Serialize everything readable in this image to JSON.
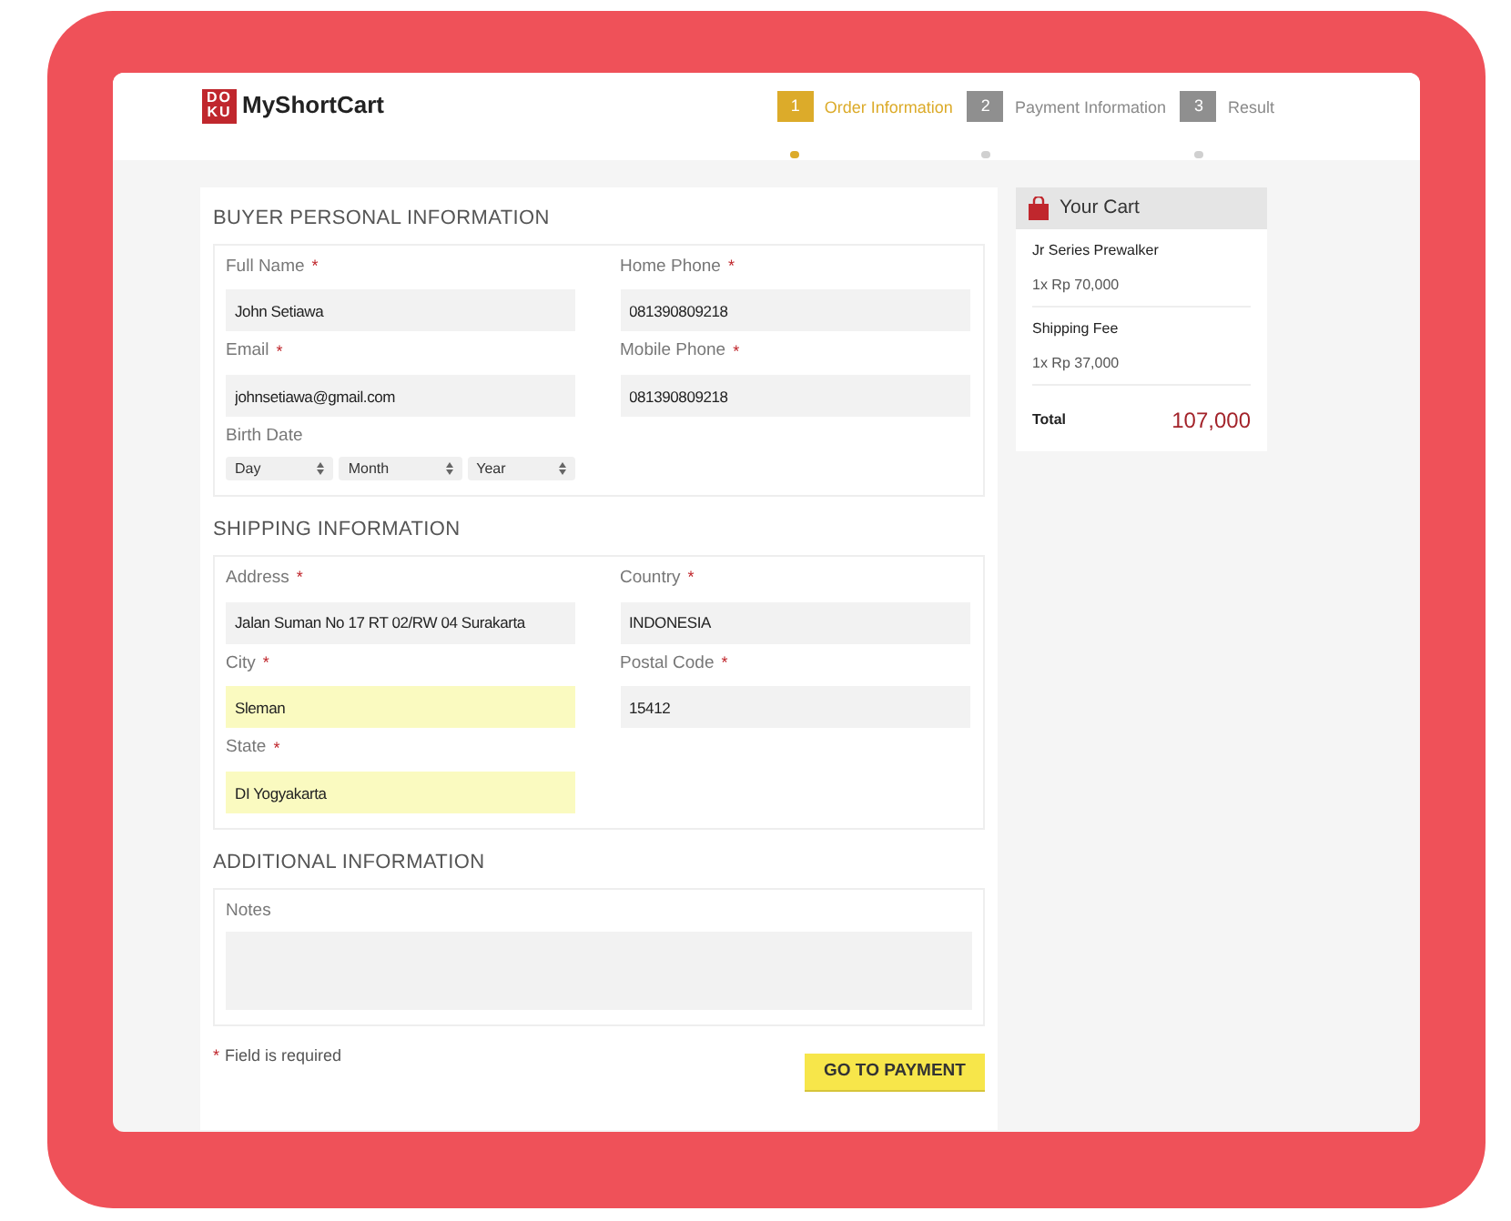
{
  "brand": {
    "logo_mark_lines": [
      "DO",
      "KU"
    ],
    "name": "MyShortCart"
  },
  "steps": [
    {
      "number": "1",
      "label": "Order Information",
      "selected": true
    },
    {
      "number": "2",
      "label": "Payment Information",
      "selected": false
    },
    {
      "number": "3",
      "label": "Result",
      "selected": false
    }
  ],
  "sections": [
    {
      "title": "BUYER PERSONAL INFORMATION",
      "fields": [
        {
          "kind": "text",
          "label": "Full Name",
          "required": true,
          "value": "John Setiawa",
          "highlighted": false
        },
        {
          "kind": "text",
          "label": "Home Phone",
          "required": true,
          "value": "081390809218",
          "highlighted": false
        },
        {
          "kind": "text",
          "label": "Email",
          "required": true,
          "value": "johnsetiawa@gmail.com",
          "highlighted": false
        },
        {
          "kind": "text",
          "label": "Mobile Phone",
          "required": true,
          "value": "081390809218",
          "highlighted": false
        },
        {
          "kind": "date",
          "label": "Birth Date",
          "required": false,
          "selects": [
            "Day",
            "Month",
            "Year"
          ]
        }
      ]
    },
    {
      "title": "SHIPPING INFORMATION",
      "fields": [
        {
          "kind": "text",
          "label": "Address",
          "required": true,
          "value": "Jalan Suman No 17 RT 02/RW 04 Surakarta",
          "highlighted": false
        },
        {
          "kind": "text",
          "label": "Country",
          "required": true,
          "value": "INDONESIA",
          "highlighted": false
        },
        {
          "kind": "text",
          "label": "City",
          "required": true,
          "value": "Sleman",
          "highlighted": true
        },
        {
          "kind": "text",
          "label": "Postal Code",
          "required": true,
          "value": "15412",
          "highlighted": false
        },
        {
          "kind": "text",
          "label": "State",
          "required": true,
          "value": "DI Yogyakarta",
          "highlighted": true
        }
      ]
    },
    {
      "title": "ADDITIONAL INFORMATION",
      "fields": [
        {
          "kind": "textarea",
          "label": "Notes",
          "required": false
        }
      ]
    }
  ],
  "required_note": {
    "mark": "*",
    "text": "Field is required"
  },
  "submit_button": "GO TO PAYMENT",
  "cart": {
    "title": "Your Cart",
    "items": [
      {
        "name": "Jr Series Prewalker",
        "price": "1x Rp 70,000"
      },
      {
        "name": "Shipping Fee",
        "price": "1x Rp 37,000"
      }
    ],
    "total_label": "Total",
    "total_value": "107,000"
  }
}
